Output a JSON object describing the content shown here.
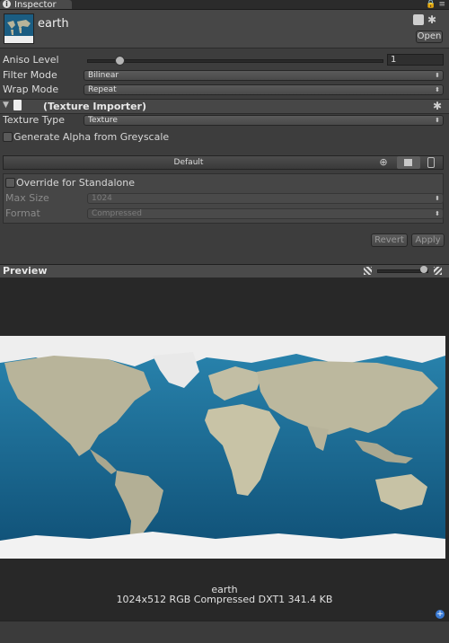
{
  "tab": {
    "label": "Inspector"
  },
  "asset": {
    "name": "earth",
    "open_label": "Open"
  },
  "aniso": {
    "label": "Aniso Level",
    "value": "1",
    "level_fraction": 0.11
  },
  "filter_mode": {
    "label": "Filter Mode",
    "value": "Bilinear"
  },
  "wrap_mode": {
    "label": "Wrap Mode",
    "value": "Repeat"
  },
  "importer": {
    "title": "(Texture Importer)"
  },
  "texture_type": {
    "label": "Texture Type",
    "value": "Texture"
  },
  "alpha_from_grey": {
    "label": "Generate Alpha from Greyscale",
    "checked": false
  },
  "platform": {
    "default_label": "Default",
    "icons": [
      "globe-icon",
      "standalone-icon",
      "mobile-icon"
    ]
  },
  "override": {
    "label": "Override for Standalone",
    "checked": false,
    "max_size_label": "Max Size",
    "max_size_value": "1024",
    "format_label": "Format",
    "format_value": "Compressed"
  },
  "buttons": {
    "revert": "Revert",
    "apply": "Apply"
  },
  "preview": {
    "title": "Preview",
    "name": "earth",
    "info": "1024x512  RGB Compressed DXT1   341.4 KB"
  },
  "colors": {
    "ocean": "#1a6a92",
    "land": "#b8b49a",
    "ice": "#f2f2f2",
    "panel": "#3d3d3d"
  }
}
